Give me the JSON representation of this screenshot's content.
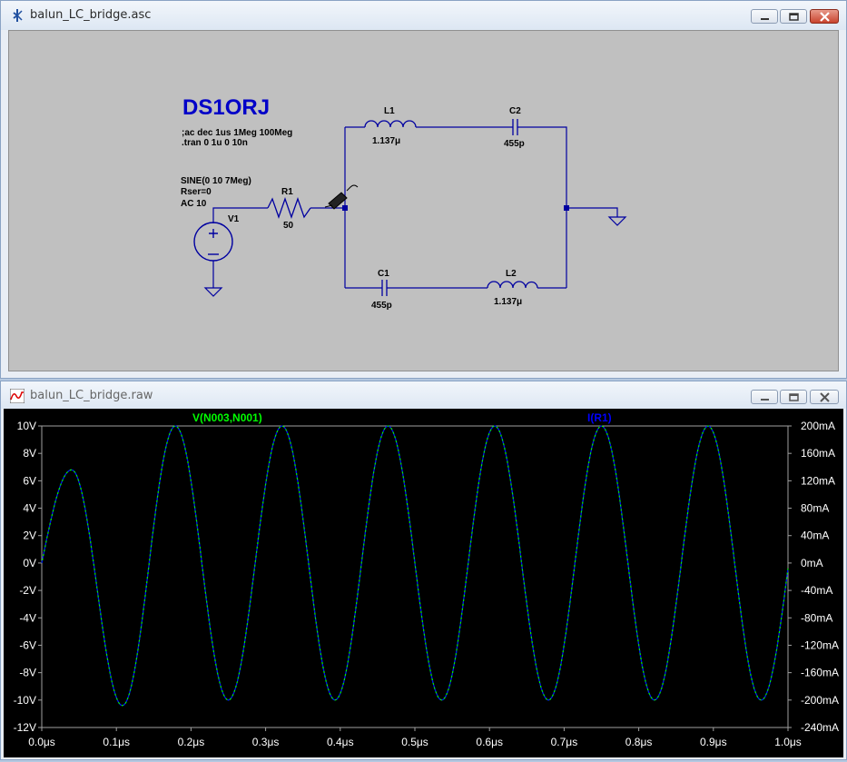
{
  "schematic_window": {
    "title": "balun_LC_bridge.asc",
    "icon": "ltspice-schematic-icon",
    "directive_title": "DS1ORJ",
    "directives": [
      ";ac dec 1us 1Meg 100Meg",
      ".tran 0 1u 0 10n"
    ],
    "source": {
      "name": "V1",
      "lines": [
        "SINE(0 10 7Meg)",
        "Rser=0",
        "AC 10"
      ]
    },
    "components": {
      "R1": {
        "name": "R1",
        "value": "50"
      },
      "L1": {
        "name": "L1",
        "value": "1.137μ"
      },
      "C2": {
        "name": "C2",
        "value": "455p"
      },
      "C1": {
        "name": "C1",
        "value": "455p"
      },
      "L2": {
        "name": "L2",
        "value": "1.137μ"
      }
    }
  },
  "waveform_window": {
    "title": "balun_LC_bridge.raw",
    "icon": "waveform-icon",
    "trace_labels": {
      "voltage": "V(N003,N001)",
      "current": "I(R1)"
    },
    "colors": {
      "voltage": "#00ff00",
      "current": "#0000ff",
      "background": "#000000",
      "axis_text": "#ffffff"
    },
    "left_ticks": [
      "10V",
      "8V",
      "6V",
      "4V",
      "2V",
      "0V",
      "-2V",
      "-4V",
      "-6V",
      "-8V",
      "-10V",
      "-12V"
    ],
    "right_ticks": [
      "200mA",
      "160mA",
      "120mA",
      "80mA",
      "40mA",
      "0mA",
      "-40mA",
      "-80mA",
      "-120mA",
      "-160mA",
      "-200mA",
      "-240mA"
    ],
    "x_ticks": [
      "0.0μs",
      "0.1μs",
      "0.2μs",
      "0.3μs",
      "0.4μs",
      "0.5μs",
      "0.6μs",
      "0.7μs",
      "0.8μs",
      "0.9μs",
      "1.0μs"
    ]
  },
  "chart_data": {
    "type": "line",
    "title": "",
    "xlabel": "",
    "ylabel": "",
    "xlim": [
      0,
      1.0
    ],
    "ylim_left": [
      -12,
      10
    ],
    "ylim_right": [
      -240,
      200
    ],
    "x_unit": "μs",
    "series": [
      {
        "name": "V(N003,N001)",
        "axis": "left",
        "x": [
          0,
          0.04,
          0.108,
          0.179,
          0.25,
          0.322,
          0.393,
          0.464,
          0.536,
          0.607,
          0.679,
          0.75,
          0.821,
          0.893,
          0.964,
          1.0
        ],
        "y": [
          0,
          6.8,
          -10.4,
          10.0,
          -10.0,
          10.0,
          -10.0,
          10.0,
          -10.0,
          10.0,
          -10.0,
          10.0,
          -10.0,
          10.0,
          -10.0,
          -0.4
        ]
      },
      {
        "name": "I(R1)",
        "axis": "right",
        "x": [
          0,
          0.04,
          0.108,
          0.179,
          0.25,
          0.322,
          0.393,
          0.464,
          0.536,
          0.607,
          0.679,
          0.75,
          0.821,
          0.893,
          0.964,
          1.0
        ],
        "y": [
          0,
          136,
          -208,
          200,
          -200,
          200,
          -200,
          200,
          -200,
          200,
          -200,
          200,
          -200,
          200,
          -200,
          -8
        ]
      }
    ]
  }
}
